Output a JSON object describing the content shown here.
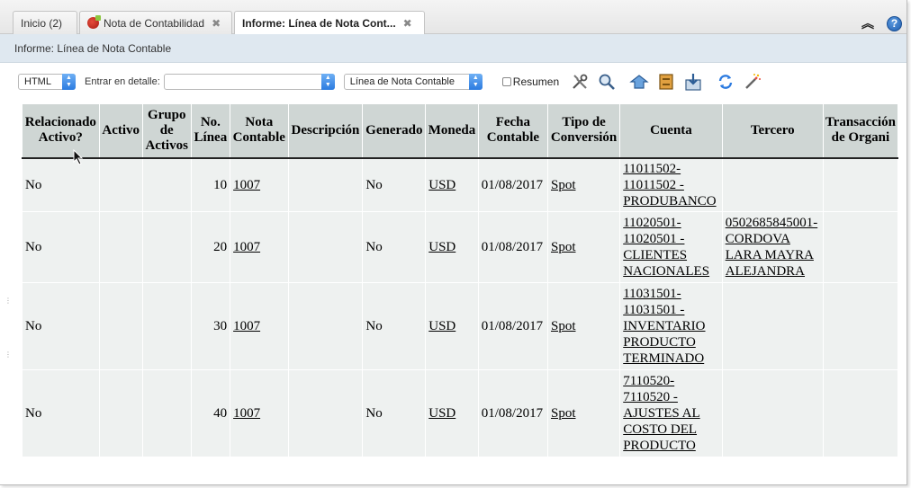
{
  "tabs": [
    {
      "label": "Inicio (2)",
      "active": false,
      "closable": false
    },
    {
      "label": "Nota de Contabilidad",
      "active": false,
      "closable": true
    },
    {
      "label": "Informe: Línea de Nota Cont...",
      "active": true,
      "closable": true
    }
  ],
  "icons": {
    "collapse": "chevron-double-up-icon",
    "help": "help-icon",
    "close": "close-icon"
  },
  "page_title": "Informe: Línea de Nota Contable",
  "toolbar": {
    "format_value": "HTML",
    "drill_label": "Entrar en detalle:",
    "drill_value": "",
    "report_value": "Línea de Nota Contable",
    "summary_label": "Resumen",
    "summary_checked": false
  },
  "table": {
    "headers": [
      "Relacionado Activo?",
      "Activo",
      "Grupo de Activos",
      "No. Línea",
      "Nota Contable",
      "Descripción",
      "Generado",
      "Moneda",
      "Fecha Contable",
      "Tipo de Conversión",
      "Cuenta",
      "Tercero",
      "Transacción de Organi"
    ],
    "rows": [
      {
        "relacionado": "No",
        "activo": "",
        "grupo": "",
        "linea": "10",
        "nota": "1007",
        "descripcion": "",
        "generado": "No",
        "moneda": "USD",
        "fecha": "01/08/2017",
        "tipo": "Spot",
        "cuenta": [
          "11011502-",
          "11011502 -",
          "PRODUBANCO"
        ],
        "tercero": [],
        "transaccion": ""
      },
      {
        "relacionado": "No",
        "activo": "",
        "grupo": "",
        "linea": "20",
        "nota": "1007",
        "descripcion": "",
        "generado": "No",
        "moneda": "USD",
        "fecha": "01/08/2017",
        "tipo": "Spot",
        "cuenta": [
          "11020501-",
          "11020501 -",
          "CLIENTES",
          "NACIONALES"
        ],
        "tercero": [
          "0502685845001-",
          "CORDOVA",
          "LARA MAYRA",
          "ALEJANDRA"
        ],
        "transaccion": ""
      },
      {
        "relacionado": "No",
        "activo": "",
        "grupo": "",
        "linea": "30",
        "nota": "1007",
        "descripcion": "",
        "generado": "No",
        "moneda": "USD",
        "fecha": "01/08/2017",
        "tipo": "Spot",
        "cuenta": [
          "11031501-",
          "11031501 -",
          "INVENTARIO",
          "PRODUCTO",
          "TERMINADO"
        ],
        "tercero": [],
        "transaccion": ""
      },
      {
        "relacionado": "No",
        "activo": "",
        "grupo": "",
        "linea": "40",
        "nota": "1007",
        "descripcion": "",
        "generado": "No",
        "moneda": "USD",
        "fecha": "01/08/2017",
        "tipo": "Spot",
        "cuenta": [
          "7110520-",
          "7110520 -",
          "AJUSTES AL",
          "COSTO DEL",
          "PRODUCTO"
        ],
        "tercero": [],
        "transaccion": ""
      }
    ]
  }
}
